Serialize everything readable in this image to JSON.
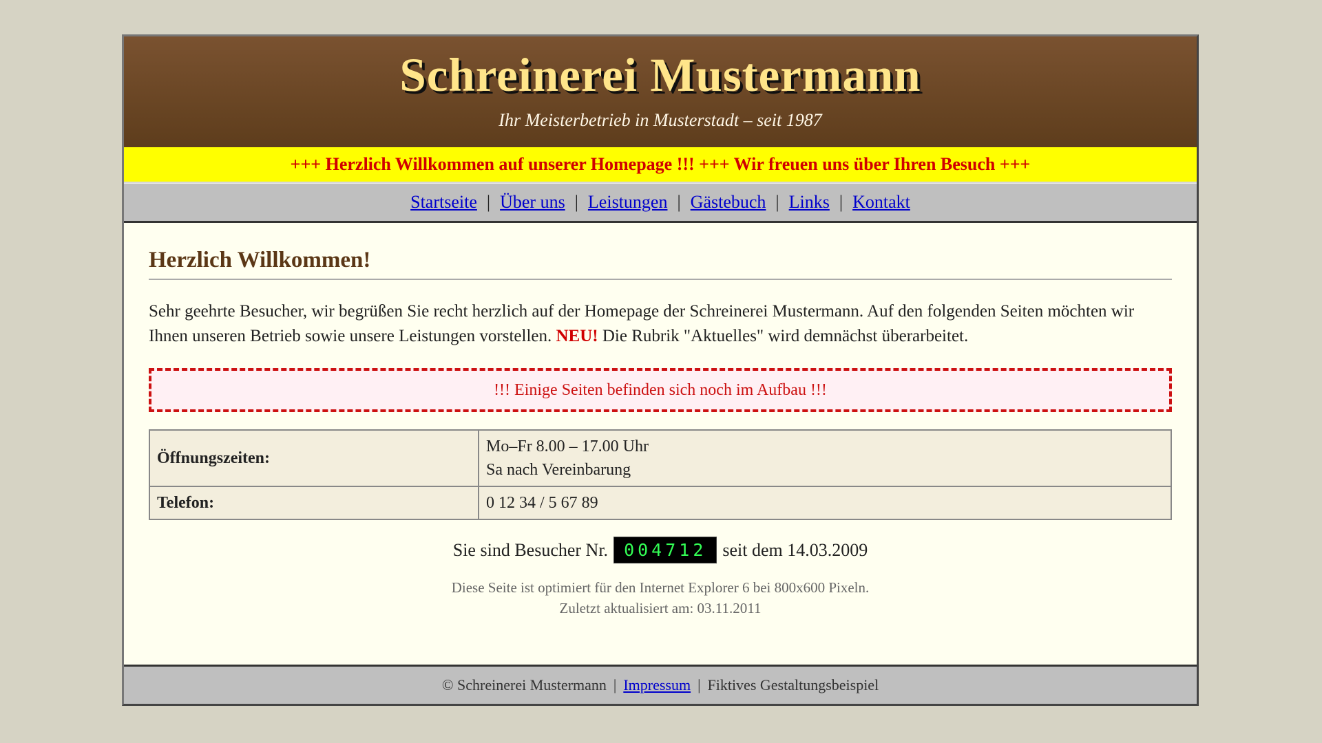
{
  "header": {
    "title": "Schreinerei Mustermann",
    "subtitle": "Ihr Meisterbetrieb in Musterstadt – seit 1987"
  },
  "ticker": "+++ Herzlich Willkommen auf unserer Homepage !!! +++ Wir freuen uns über Ihren Besuch +++",
  "nav": {
    "items": [
      "Startseite",
      "Über uns",
      "Leistungen",
      "Gästebuch",
      "Links",
      "Kontakt"
    ],
    "separator": "|"
  },
  "content": {
    "heading": "Herzlich Willkommen!",
    "intro_text": "Sehr geehrte Besucher, wir begrüßen Sie recht herzlich auf der Homepage der Schreinerei Mustermann. Auf den folgenden Seiten möchten wir Ihnen unseren Betrieb sowie unsere Leistungen vorstellen.",
    "intro_new": "NEU!",
    "intro_tail": "Die Rubrik \"Aktuelles\" wird demnächst überarbeitet.",
    "notice": "!!! Einige Seiten befinden sich noch im Aufbau !!!",
    "table": {
      "rows": [
        {
          "label": "Öffnungszeiten:",
          "line1": "Mo–Fr 8.00 – 17.00 Uhr",
          "line2": "Sa nach Vereinbarung"
        },
        {
          "label": "Telefon:",
          "line1": "0 12 34 / 5 67 89"
        }
      ]
    },
    "counter": {
      "prefix": "Sie sind Besucher Nr.",
      "value": "004712",
      "suffix": "seit dem 14.03.2009"
    },
    "optimized": "Diese Seite ist optimiert für den Internet Explorer 6 bei 800x600 Pixeln.",
    "updated": "Zuletzt aktualisiert am: 03.11.2011"
  },
  "footer": {
    "copyright": "© Schreinerei Mustermann",
    "impressum": "Impressum",
    "note": "Fiktives Gestaltungsbeispiel",
    "separator": "|"
  },
  "colors": {
    "header_brown": "#6b4624",
    "title_gold": "#ffe58a",
    "ticker_yellow": "#ffff00",
    "alert_red": "#d00000",
    "link_blue": "#0000cc",
    "counter_green": "#33ff55"
  }
}
